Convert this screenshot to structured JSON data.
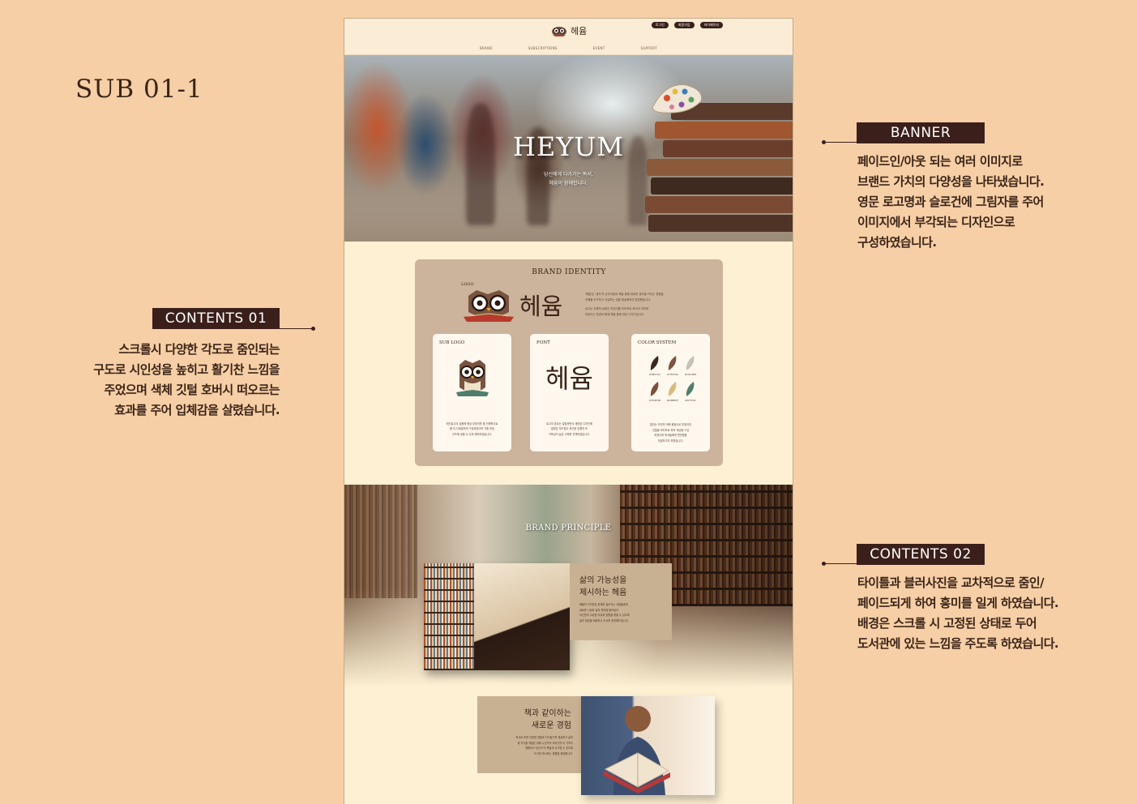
{
  "page_label": "SUB 01-1",
  "annotations": {
    "banner": {
      "tag": "BANNER",
      "lines": [
        "페이드인/아웃 되는 여러 이미지로",
        "브랜드 가치의 다양성을 나타냈습니다.",
        "영문 로고명과 슬로건에 그림자를 주어",
        "이미지에서 부각되는 디자인으로",
        "구성하였습니다."
      ]
    },
    "contents01": {
      "tag": "CONTENTS 01",
      "lines": [
        "스크롤시 다양한 각도로 줌인되는",
        "구도로 시인성을 높히고 활기찬 느낌을",
        "주었으며 색체 깃털 호버시 떠오르는",
        "효과를 주어 입체감을 살렸습니다."
      ]
    },
    "contents02": {
      "tag": "CONTENTS 02",
      "lines": [
        "타이틀과 블러사진을 교차적으로 줌인/",
        "페이드되게 하여 흥미를 일게 하였습니다.",
        "배경은 스크롤 시 고정된 상태로 두어",
        "도서관에 있는 느낌을 주도록 하였습니다."
      ]
    }
  },
  "mock": {
    "logo_text": "헤윰",
    "header_pills": [
      "로그인",
      "회원가입",
      "마이페이지"
    ],
    "nav": [
      "BRAND",
      "SUBSCRIPTIONS",
      "EVENT",
      "SUPPORT"
    ],
    "banner": {
      "title": "HEYUM",
      "slogan_lines": [
        "당신에게 다가가는 독서,",
        "헤윰이 함께합니다."
      ]
    },
    "brand_identity": {
      "title": "BRAND IDENTITY",
      "logo_label": "LOGO",
      "logo_text": "헤윰",
      "desc_lines": [
        "'헤윰'은 '생각'의 순우리말로 책을 통해 새로운 생각을 키우는 경험을",
        "지혜를 추구하고 사유하는 것을 형상화하여 표현했습니다.",
        "",
        "로고는 지혜의 상징인 부엉이를 모티프로 독서의 의미와",
        "부엉이는 안경과 함께 책을 품에 안은 디자인입니다."
      ],
      "cards": [
        {
          "title": "SUB LOGO",
          "text_lines": [
            "메인로고의 심볼에 형상 부엉이를 을 전체적으로",
            "좀 더 디테일하게 구성하였으며 각종 부엉",
            "굿즈에 넣을 수 있게 제작하였습니다."
          ]
        },
        {
          "title": "FONT",
          "font_sample": "헤윰",
          "text_lines": [
            "로고의 폰트는 깔끔하면서 세련된 디자인에",
            "알맞은 부드럽고 포근한 흐름과 또",
            "가독성이 높은 서체를 선택하였습니다."
          ]
        },
        {
          "title": "COLOR SYSTEM",
          "text_lines": [
            "컬러는 자연의 색에 중점으로 부엉이의",
            "깃털을 모티프로 하여 색상을 구성",
            "하였으며 독자들에게 편안함을",
            "전달하고자 하였습니다."
          ]
        }
      ],
      "colors": [
        "#3B2722",
        "#7E5540",
        "#C6C3B6",
        "#7E4E3B",
        "#D8BB7F",
        "#4F7F6C"
      ],
      "color_labels": [
        "#3B2722",
        "#7E5540",
        "#C6C3B6",
        "#7E4E3B",
        "#D8BB7F",
        "#4F7F6C"
      ]
    },
    "brand_principle": {
      "title": "BRAND PRINCIPLE",
      "block1": {
        "title_lines": [
          "삶의 가능성을",
          "제시하는 헤윰"
        ],
        "body_lines": [
          "헤윰의 가치관은 현재를 살아가는 사람들에게",
          "새로운 시야와 삶의 활력을 불어넣어",
          "자신만의 고유한 여유와 방향을 찾을 수 있도록",
          "삶의 영감을 제공하고 도서를 추천해드립니다."
        ]
      },
      "block2": {
        "title_lines": [
          "책과 같이하는",
          "새로운 경험"
        ],
        "body_lines": [
          "독서로 또한 다양한 경험과 지식탐구를 제공하고 삶의",
          "새 지식을 개발은 위해 누군가의 이야기를 더 가까이",
          "경험하고 당신이 더 폭넓게 사고할 수 있도록",
          "도서를 제시하는 경험을 제공합니다."
        ]
      }
    }
  }
}
